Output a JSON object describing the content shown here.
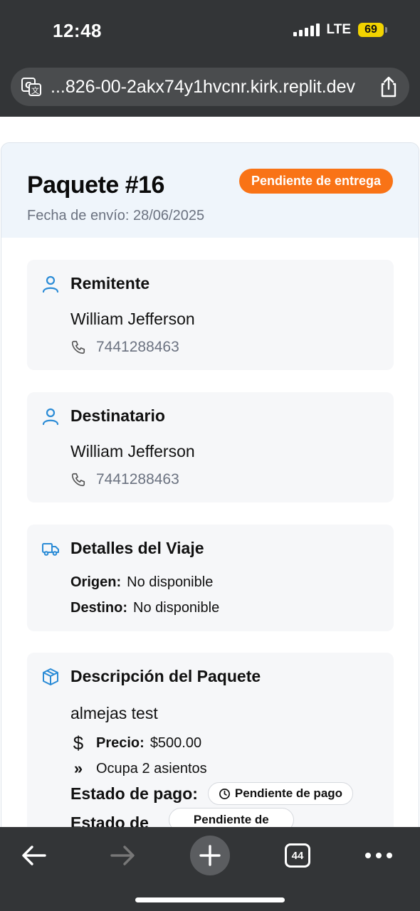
{
  "status_bar": {
    "time": "12:48",
    "network": "LTE",
    "battery": "69"
  },
  "browser": {
    "url": "...826-00-2akx74y1hvcnr.kirk.replit.dev",
    "tabs_count": "44"
  },
  "package": {
    "title": "Paquete #16",
    "ship_date": "Fecha de envío: 28/06/2025",
    "status": "Pendiente de entrega"
  },
  "sender": {
    "heading": "Remitente",
    "name": "William Jefferson",
    "phone": "7441288463"
  },
  "recipient": {
    "heading": "Destinatario",
    "name": "William Jefferson",
    "phone": "7441288463"
  },
  "trip": {
    "heading": "Detalles del Viaje",
    "origin_label": "Origen:",
    "origin_value": "No disponible",
    "dest_label": "Destino:",
    "dest_value": "No disponible"
  },
  "description": {
    "heading": "Descripción del Paquete",
    "text": "almejas test",
    "price_label": "Precio:",
    "price_value": "$500.00",
    "seats": "Ocupa 2 asientos",
    "payment_label": "Estado de pago:",
    "payment_status": "Pendiente de pago",
    "delivery_label": "Estado de",
    "delivery_status": "Pendiente de"
  },
  "colors": {
    "accent": "#2a8bd6",
    "badge": "#f97316",
    "chrome": "#333537"
  }
}
